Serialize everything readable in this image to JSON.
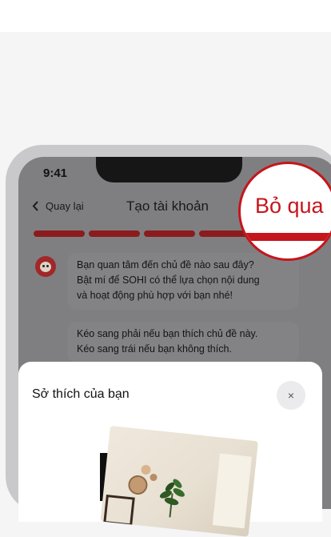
{
  "status_bar": {
    "time": "9:41"
  },
  "header": {
    "back_label": "Quay lại",
    "title": "Tạo tài khoản"
  },
  "progress": {
    "segments": 5
  },
  "chat": {
    "messages": [
      {
        "lines": [
          "Bạn quan tâm đến chủ đề nào sau đây?",
          "Bật mí để SOHI có thể lựa chọn nội dung",
          "và hoạt động phù hợp với bạn nhé!"
        ]
      },
      {
        "lines": [
          "Kéo sang phải nếu bạn thích chủ đề này.",
          "Kéo sang trái nếu bạn không thích."
        ]
      }
    ]
  },
  "zoom_callout": {
    "label": "Bỏ qua"
  },
  "sheet": {
    "title": "Sở thích của bạn",
    "close_glyph": "×"
  },
  "colors": {
    "accent": "#c4161c",
    "progress_dim": "#8c1b1d",
    "overlay": "#7f7f81"
  }
}
